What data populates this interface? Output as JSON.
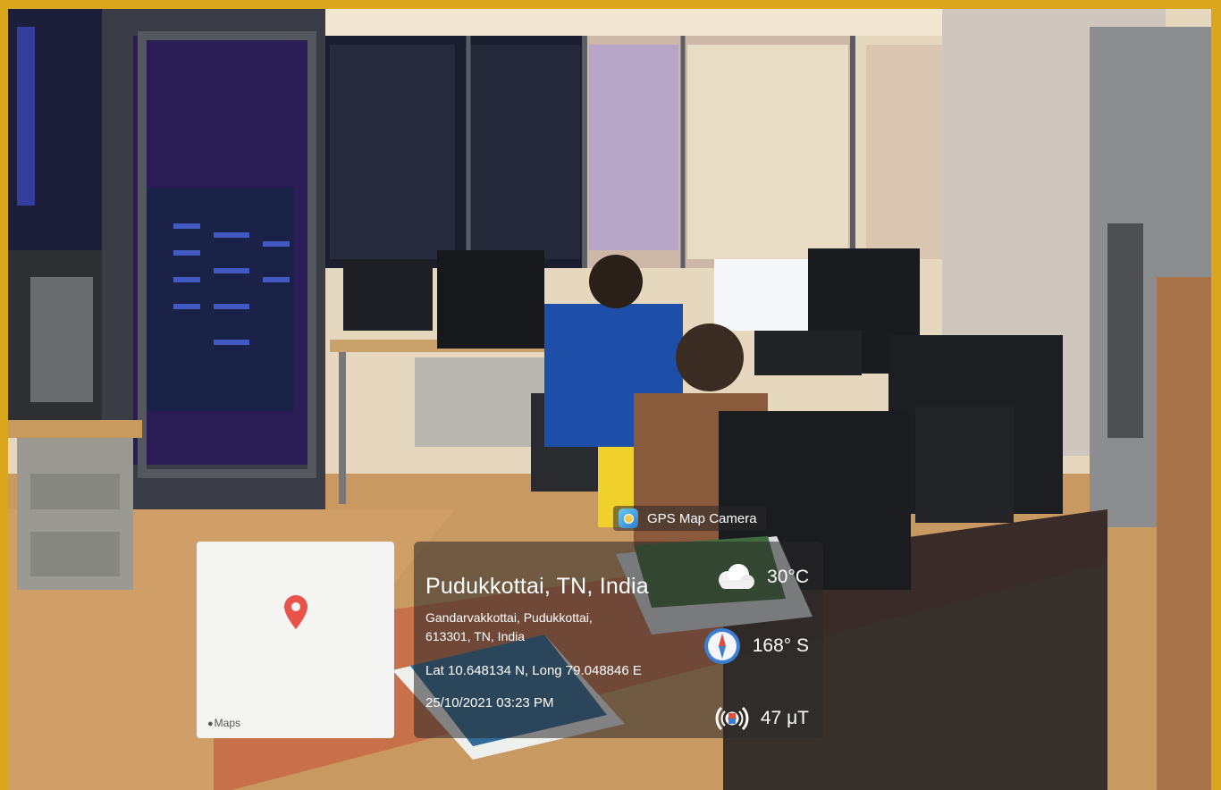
{
  "overlay": {
    "app_name": "GPS Map Camera",
    "map_brand": "Maps",
    "location_title": "Pudukkottai, TN, India",
    "address_line1": "Gandarvakkottai, Pudukkottai,",
    "address_line2": "613301, TN, India",
    "coordinates": "Lat 10.648134 N, Long 79.048846 E",
    "datetime": "25/10/2021 03:23 PM",
    "temperature": "30°C",
    "direction": "168° S",
    "magnetic_field": "47 μT"
  },
  "icons": [
    "map-pin-icon",
    "apple-icon",
    "camera-app-icon",
    "cloud-icon",
    "compass-icon",
    "magnet-icon"
  ],
  "colors": {
    "frame": "#d9a61c",
    "pin": "#e8544a",
    "wall": "#e9dcc4",
    "floor": "#c99a5e",
    "desk": "#c87046"
  }
}
